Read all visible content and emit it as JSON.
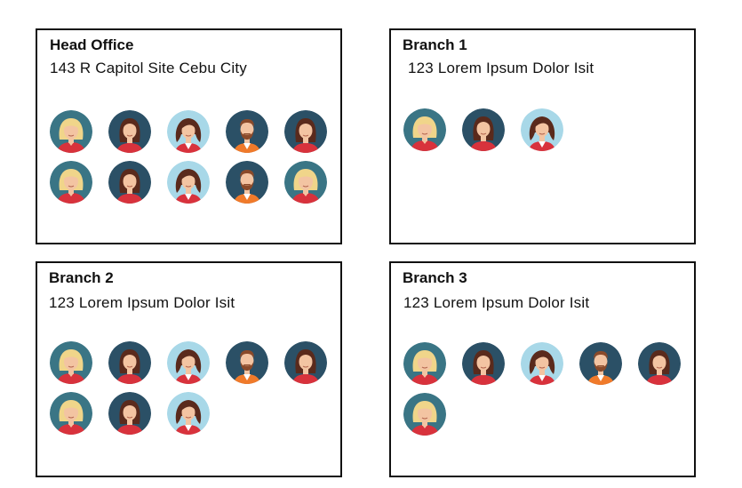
{
  "offices": [
    {
      "title": "Head Office",
      "address": "143 R Capitol Site Cebu City",
      "staff": [
        "blonde-woman",
        "brunette-woman",
        "curly-woman",
        "bearded-man",
        "brunette-woman",
        "blonde-woman",
        "brunette-woman",
        "curly-woman",
        "bearded-man",
        "blonde-woman"
      ]
    },
    {
      "title": "Branch 1",
      "address": "123 Lorem Ipsum Dolor Isit",
      "staff": [
        "blonde-woman",
        "brunette-woman",
        "curly-woman"
      ]
    },
    {
      "title": "Branch 2",
      "address": "123 Lorem Ipsum Dolor Isit",
      "staff": [
        "blonde-woman",
        "brunette-woman",
        "curly-woman",
        "bearded-man",
        "brunette-woman",
        "blonde-woman",
        "brunette-woman",
        "curly-woman"
      ]
    },
    {
      "title": "Branch 3",
      "address": "123 Lorem Ipsum Dolor Isit",
      "staff": [
        "blonde-woman",
        "brunette-woman",
        "curly-woman",
        "bearded-man",
        "brunette-woman",
        "blonde-woman"
      ]
    }
  ],
  "colors": {
    "teal_background": "#3a7585",
    "navy_background": "#2b5066",
    "light_blue_background": "#a8d8e8",
    "skin": "#f3c4a2",
    "blonde_hair": "#f0d58a",
    "brown_hair": "#5a2a1c",
    "red_top": "#d8323c",
    "orange_top": "#f07a2a",
    "border": "#111111"
  }
}
